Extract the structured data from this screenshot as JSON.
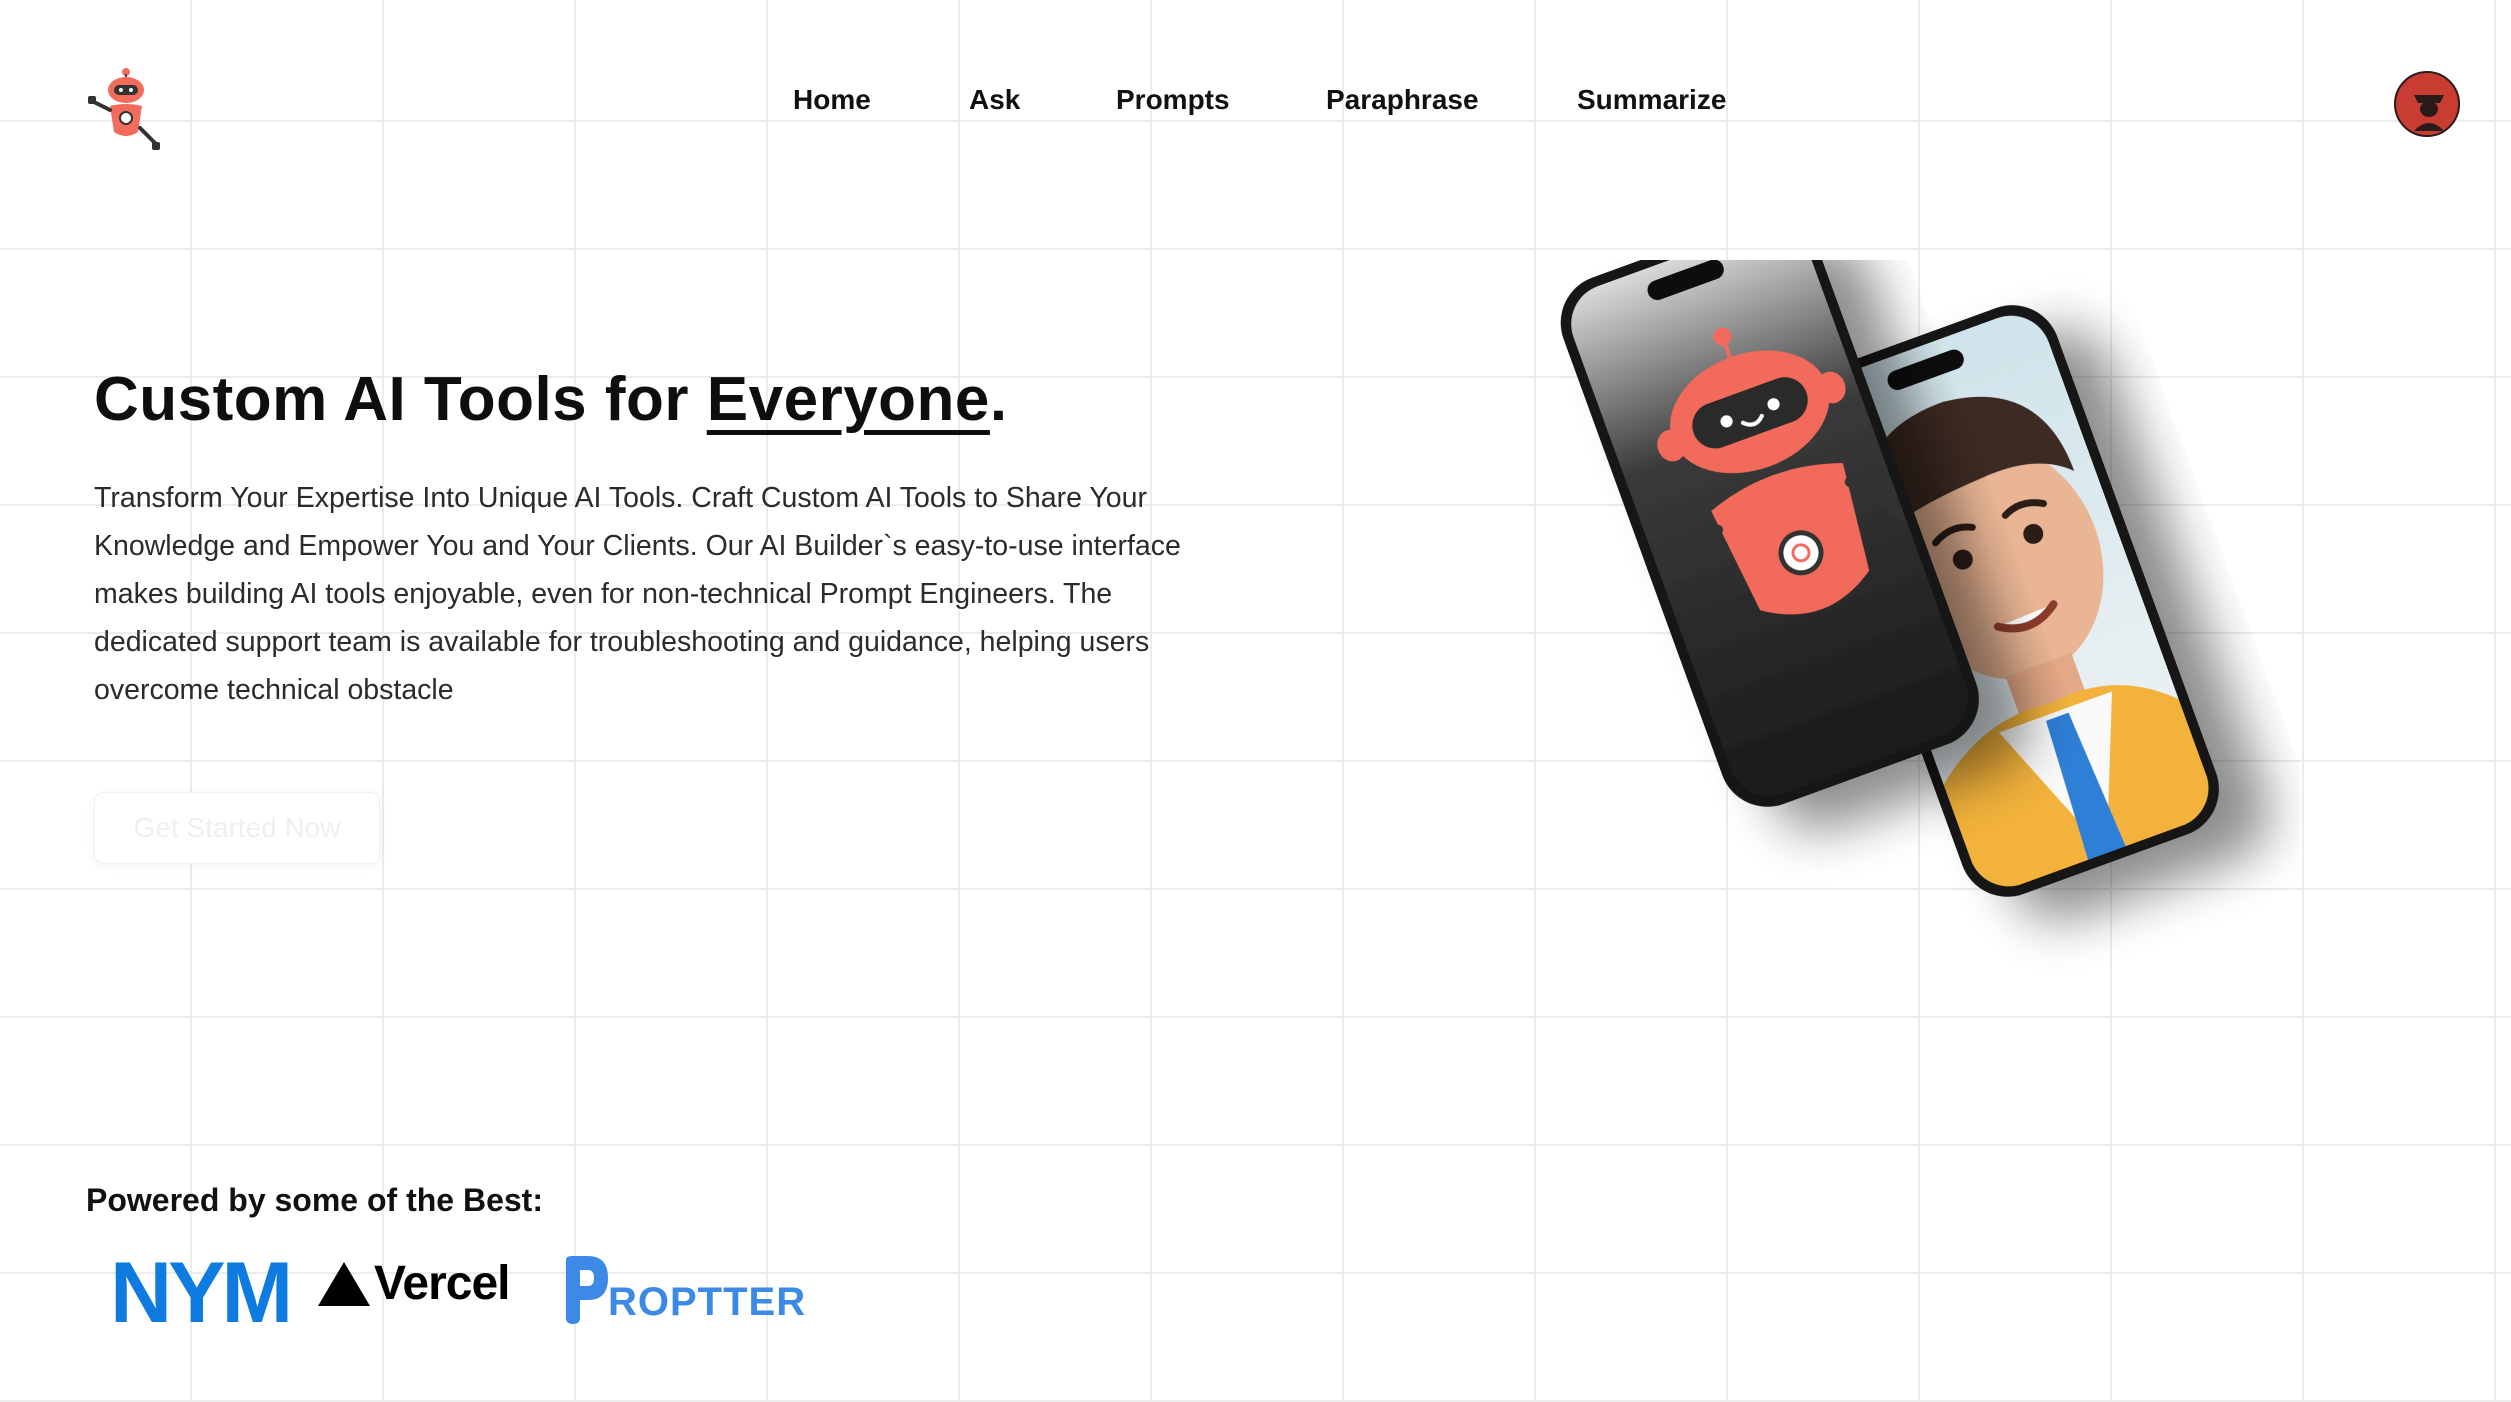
{
  "nav": {
    "items": [
      {
        "label": "Home"
      },
      {
        "label": "Ask"
      },
      {
        "label": "Prompts"
      },
      {
        "label": "Paraphrase"
      },
      {
        "label": "Summarize"
      }
    ]
  },
  "hero": {
    "title_prefix": "Custom AI Tools for ",
    "title_highlight": "Everyone",
    "title_suffix": ".",
    "description": "Transform Your Expertise Into Unique AI Tools. Craft Custom AI Tools to Share Your Knowledge and Empower You and Your Clients. Our AI Builder`s easy-to-use interface makes building AI tools enjoyable, even for non-technical Prompt Engineers. The dedicated support team is available for troubleshooting and guidance, helping users overcome technical obstacle",
    "cta_label": "Get Started Now"
  },
  "powered": {
    "title": "Powered by some of the Best:",
    "brands": [
      {
        "name": "NYM"
      },
      {
        "name": "Vercel"
      },
      {
        "name": "ROPTTER"
      }
    ]
  },
  "colors": {
    "accent": "#f26b5b",
    "nym_blue": "#0e7be0",
    "propter_blue": "#3d8ae6",
    "grid": "#ececec"
  },
  "icons": {
    "logo": "robot-logo-icon",
    "avatar": "user-avatar-icon"
  }
}
